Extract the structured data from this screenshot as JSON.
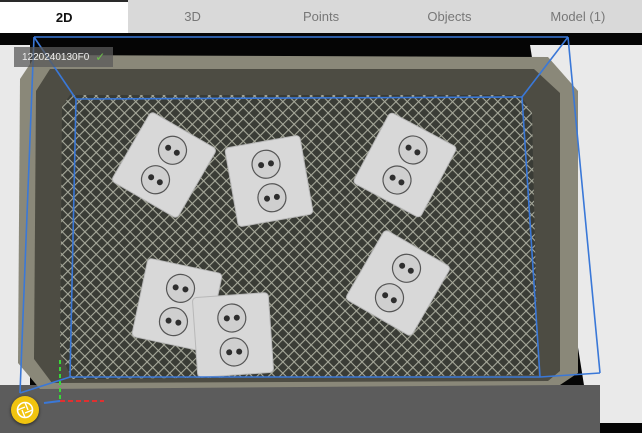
{
  "tabs": [
    {
      "label": "2D",
      "active": true
    },
    {
      "label": "3D",
      "active": false
    },
    {
      "label": "Points",
      "active": false
    },
    {
      "label": "Objects",
      "active": false
    },
    {
      "label": "Model (1)",
      "active": false
    }
  ],
  "viewport": {
    "camera_id": "1220240130F0",
    "status_icon": "checkmark-icon",
    "bbox_color": "#3a78d8",
    "action_button_icon": "aperture-icon",
    "action_button_color": "#f1c40f"
  }
}
